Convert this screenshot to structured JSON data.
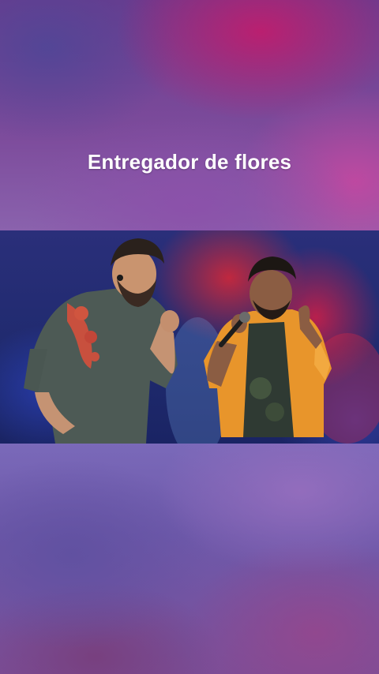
{
  "post": {
    "caption": "Entregador de flores"
  },
  "video": {
    "icon": "video-frame"
  },
  "colors": {
    "caption": "#ffffff",
    "background_top": "#7d4c9c",
    "background_bottom": "#6e59aa"
  }
}
